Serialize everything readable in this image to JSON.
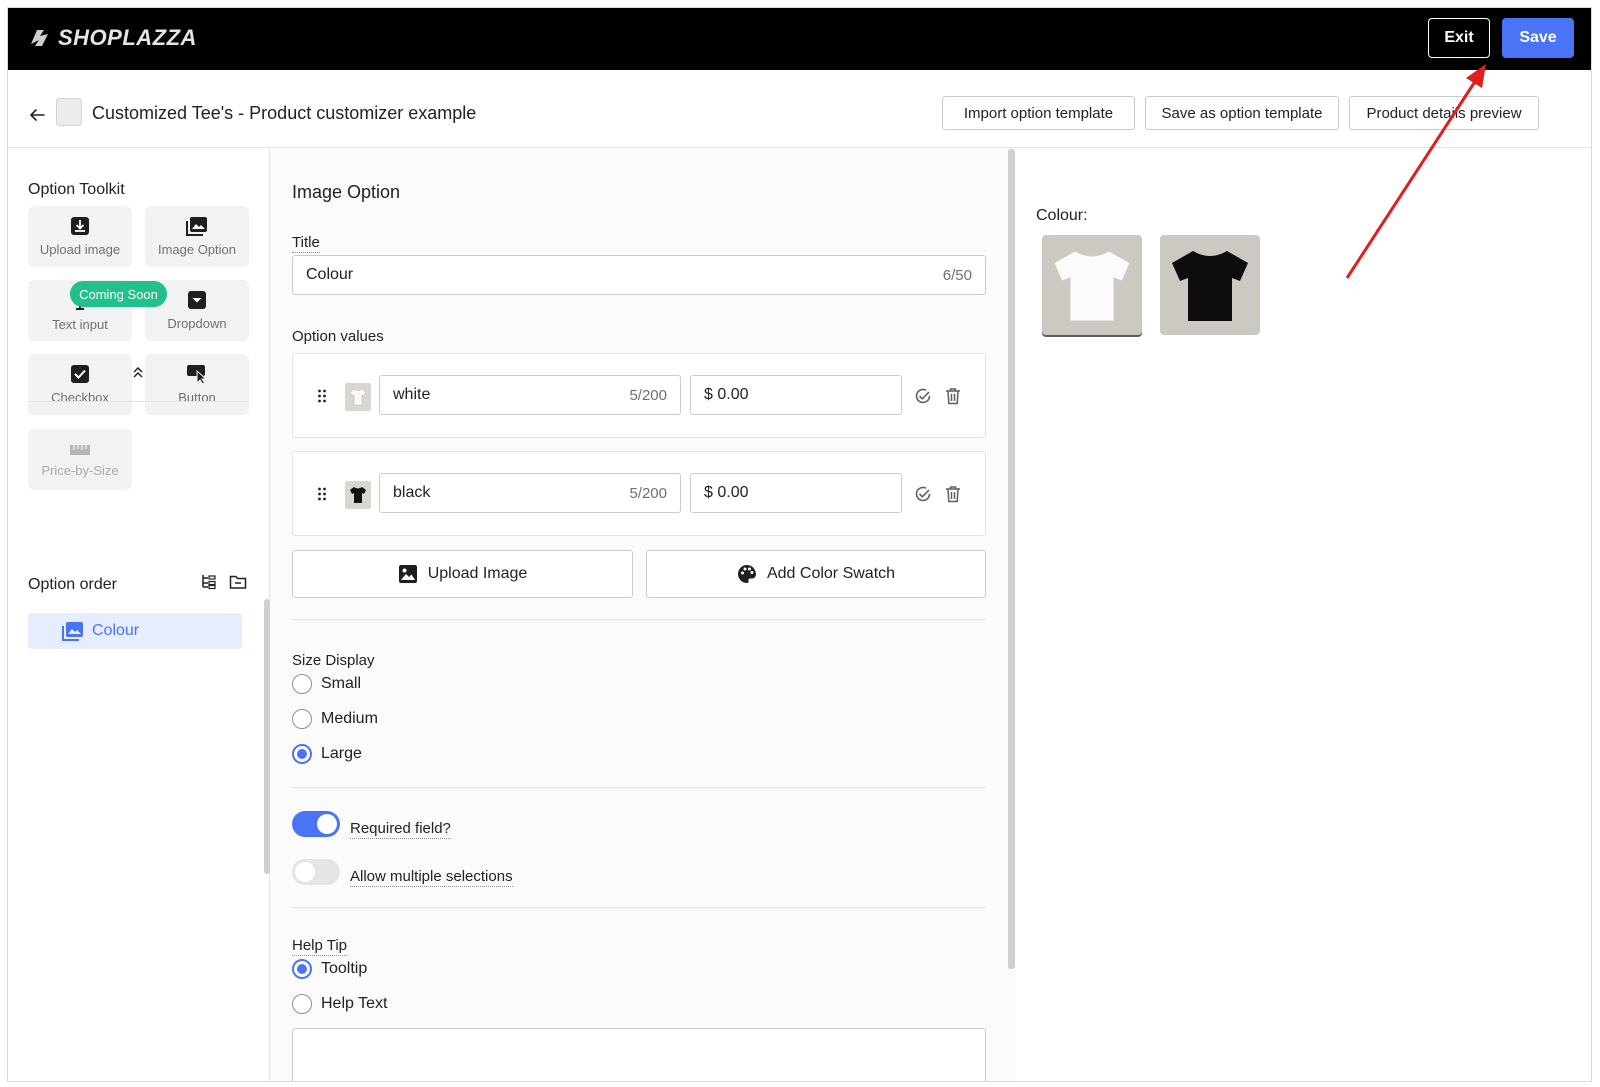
{
  "topbar": {
    "logo_text": "SHOPLAZZA",
    "exit_label": "Exit",
    "save_label": "Save",
    "save_color": "#4a74f5"
  },
  "header": {
    "title": "Customized Tee's - Product customizer example",
    "buttons": [
      "Import option template",
      "Save as option template",
      "Product details preview"
    ]
  },
  "sidebar": {
    "toolkit_title": "Option Toolkit",
    "tools": [
      {
        "label": "Upload image",
        "icon": "upload-image-icon"
      },
      {
        "label": "Image Option",
        "icon": "image-option-icon"
      },
      {
        "label": "Text input",
        "icon": "text-input-icon"
      },
      {
        "label": "Dropdown",
        "icon": "dropdown-icon"
      },
      {
        "label": "Checkbox",
        "icon": "checkbox-icon"
      },
      {
        "label": "Button",
        "icon": "button-icon"
      },
      {
        "label": "Price-by-Size",
        "icon": "ruler-icon"
      }
    ],
    "coming_soon": "Coming Soon",
    "order_title": "Option order",
    "order_items": [
      "Colour"
    ]
  },
  "editor": {
    "heading": "Image Option",
    "title_label": "Title",
    "title_value": "Colour",
    "title_count": "6/50",
    "option_values_label": "Option values",
    "values": [
      {
        "name": "white",
        "count": "5/200",
        "price": "$ 0.00"
      },
      {
        "name": "black",
        "count": "5/200",
        "price": "$ 0.00"
      }
    ],
    "upload_image_label": "Upload Image",
    "add_swatch_label": "Add Color Swatch",
    "size_display_label": "Size Display",
    "size_options": [
      "Small",
      "Medium",
      "Large"
    ],
    "size_selected": "Large",
    "required_label": "Required field?",
    "required_on": true,
    "multiple_label": "Allow multiple selections",
    "multiple_on": false,
    "help_tip_label": "Help Tip",
    "help_options": [
      "Tooltip",
      "Help Text"
    ],
    "help_selected": "Tooltip"
  },
  "preview": {
    "colour_label": "Colour:",
    "swatches": [
      "white-tshirt",
      "black-tshirt"
    ],
    "selected": "white-tshirt"
  }
}
